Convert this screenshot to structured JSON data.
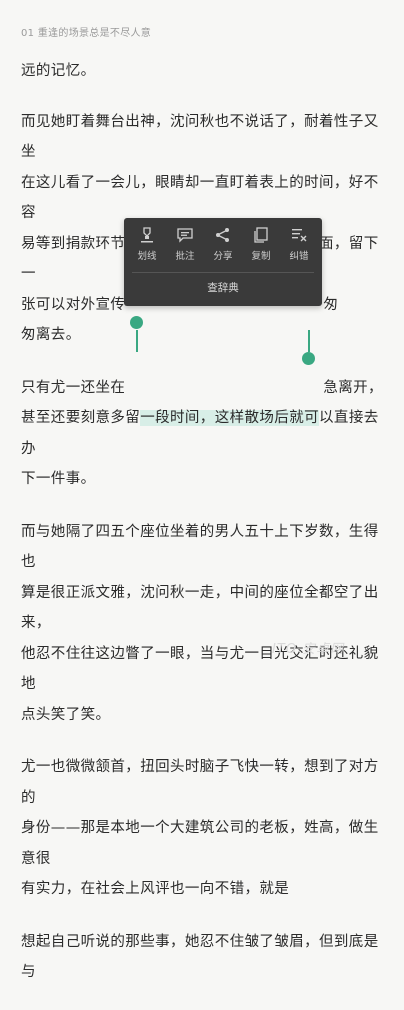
{
  "header": {
    "chapter_title": "01 重逢的场景总是不尽人意"
  },
  "paragraphs": [
    {
      "lines": [
        "远的记忆。"
      ]
    },
    {
      "lines": [
        "而见她盯着舞台出神，沈问秋也不说话了，耐着性子又坐",
        "在这儿看了一会儿，眼睛却一直盯着表上的时间，好不容",
        "易等到捐款环节，他作为公司老板上去露了个面，留下一",
        "张可以对外宣传",
        "匆",
        "匆离去。"
      ]
    },
    {
      "lines": [
        "只有尤一还坐在",
        "急离开，",
        "甚至还要刻意多留",
        "一段时间，这样散场后就可",
        "以直接去办",
        "下一件事。"
      ]
    },
    {
      "lines": [
        "而与她隔了四五个座位坐着的男人五十上下岁数，生得也",
        "算是很正派文雅，沈问秋一走，中间的座位全都空了出来，",
        "他忍不住往这边瞥了一眼，当与尤一目光交汇时还礼貌地",
        "点头笑了笑。"
      ]
    },
    {
      "lines": [
        "尤一也微微颔首，扭回头时脑子飞快一转，想到了对方的",
        "身份——那是本地一个大建筑公司的老板，姓高，做生意很",
        "有实力，在社会上风评也一向不错，就是"
      ]
    },
    {
      "lines": [
        "想起自己听说的那些事，她忍不住皱了皱眉，但到底是与"
      ]
    }
  ],
  "popup": {
    "actions": [
      {
        "label": "划线",
        "icon": "underline-icon"
      },
      {
        "label": "批注",
        "icon": "note-icon"
      },
      {
        "label": "分享",
        "icon": "share-icon"
      },
      {
        "label": "复制",
        "icon": "copy-icon"
      },
      {
        "label": "纠错",
        "icon": "correction-icon"
      }
    ],
    "lookup_label": "查辞典"
  },
  "watermark": "ITO 安卓网"
}
